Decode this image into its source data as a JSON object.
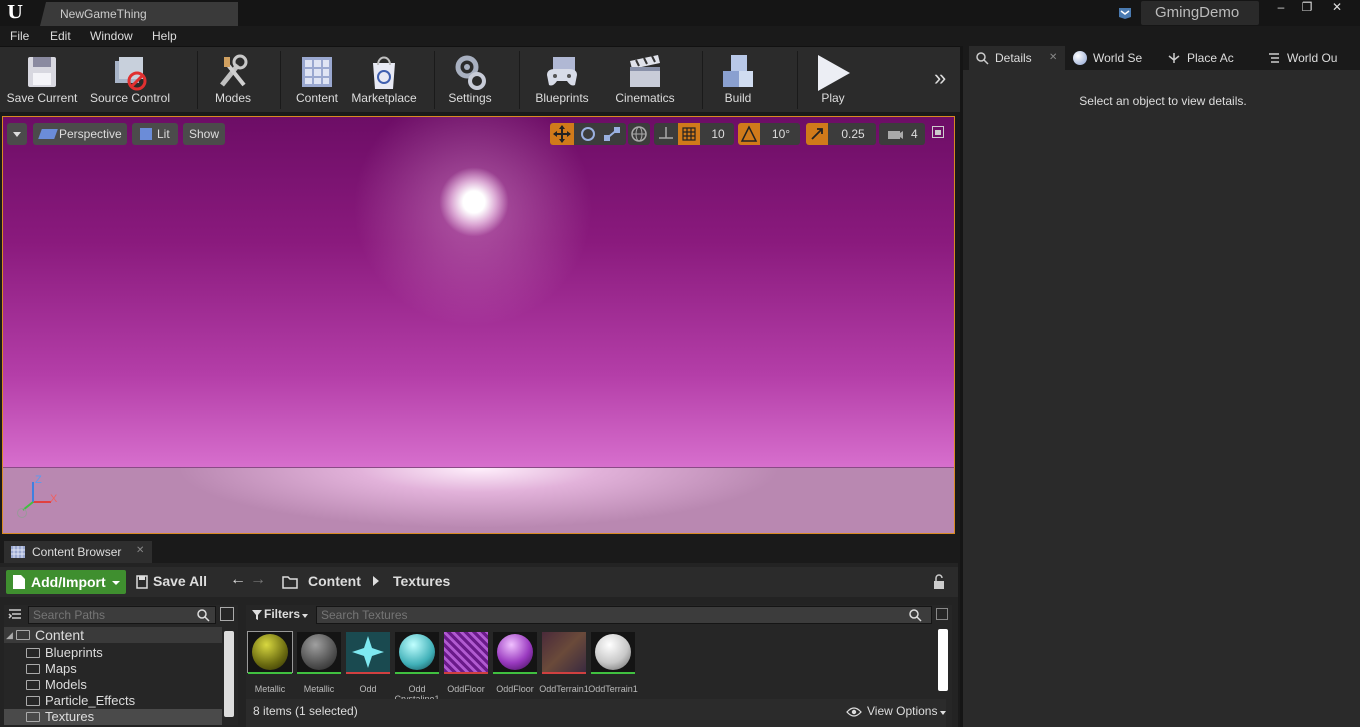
{
  "titlebar": {
    "tab_title": "NewGameThing",
    "project_name": "GmingDemo",
    "controls": [
      "–",
      "❐",
      "✕"
    ]
  },
  "menu": [
    "File",
    "Edit",
    "Window",
    "Help"
  ],
  "toolbar": {
    "items": [
      "Save Current",
      "Source Control",
      "Modes",
      "Content",
      "Marketplace",
      "Settings",
      "Blueprints",
      "Cinematics",
      "Build",
      "Play"
    ],
    "more_glyph": "»"
  },
  "viewport": {
    "perspective_label": "Perspective",
    "lit_label": "Lit",
    "show_label": "Show",
    "grid_snap": "10",
    "rotation_snap": "10°",
    "scale_snap": "0.25",
    "camera_speed": "4",
    "axis_z": "Z",
    "axis_x": "X",
    "colors": {
      "border": "#d88a22",
      "sky_top": "#6d0d66",
      "sky_bottom": "#efa2e6"
    }
  },
  "right_panel": {
    "tabs": [
      "Details",
      "World Se",
      "Place Ac",
      "World Ou"
    ],
    "details_message": "Select an object to view details."
  },
  "content_browser": {
    "tab_label": "Content Browser",
    "add_import_label": "Add/Import",
    "save_all_label": "Save All",
    "breadcrumb": [
      "Content",
      "Textures"
    ],
    "search_paths_placeholder": "Search Paths",
    "filters_label": "Filters",
    "search_textures_placeholder": "Search Textures",
    "tree": [
      "Content",
      "Blueprints",
      "Maps",
      "Models",
      "Particle_Effects",
      "Textures"
    ],
    "assets": [
      {
        "line1": "Metallic",
        "line2": ""
      },
      {
        "line1": "Metallic",
        "line2": ""
      },
      {
        "line1": "Odd",
        "line2": ""
      },
      {
        "line1": "Odd",
        "line2": "Crystaline1"
      },
      {
        "line1": "OddFloor",
        "line2": ""
      },
      {
        "line1": "OddFloor",
        "line2": ""
      },
      {
        "line1": "OddTerrain1",
        "line2": ""
      },
      {
        "line1": "OddTerrain1",
        "line2": ""
      }
    ],
    "item_count": "8 items (1 selected)",
    "view_options_label": "View Options"
  }
}
